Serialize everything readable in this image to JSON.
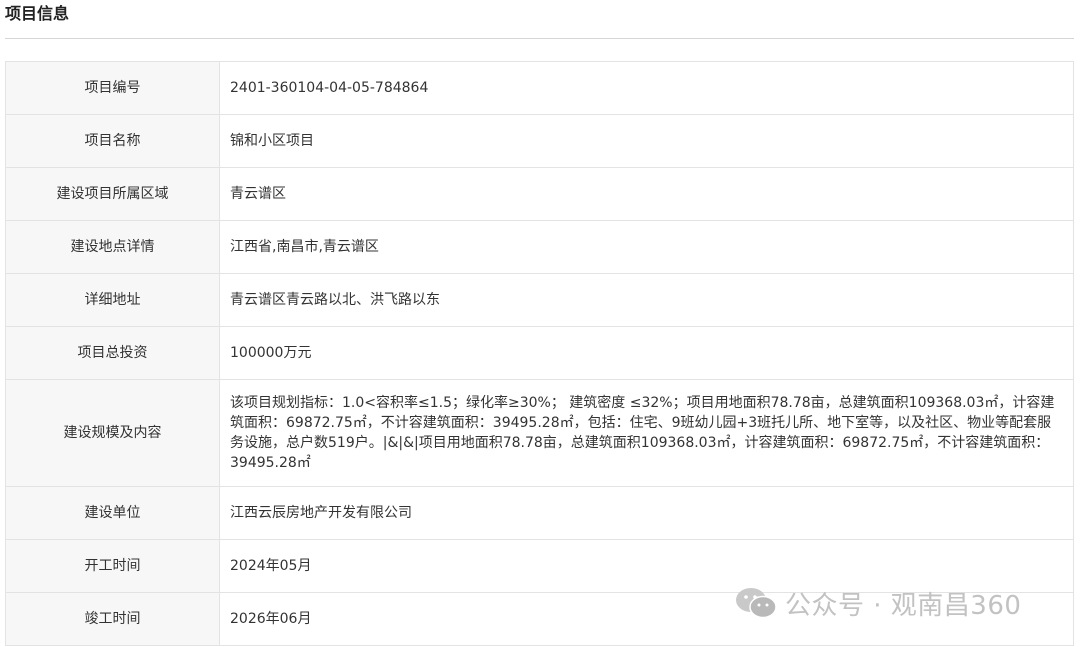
{
  "section": {
    "title": "项目信息"
  },
  "rows": [
    {
      "label": "项目编号",
      "value": "2401-360104-04-05-784864"
    },
    {
      "label": "项目名称",
      "value": "锦和小区项目"
    },
    {
      "label": "建设项目所属区域",
      "value": "青云谱区"
    },
    {
      "label": "建设地点详情",
      "value": "江西省,南昌市,青云谱区"
    },
    {
      "label": "详细地址",
      "value": "青云谱区青云路以北、洪飞路以东"
    },
    {
      "label": "项目总投资",
      "value": "100000万元"
    },
    {
      "label": "建设规模及内容",
      "value": "该项目规划指标：1.0<容积率≤1.5；绿化率≥30%；  建筑密度 ≤32%；项目用地面积78.78亩，总建筑面积109368.03㎡，计容建筑面积：69872.75㎡，不计容建筑面积：39495.28㎡，包括：住宅、9班幼儿园+3班托儿所、地下室等，以及社区、物业等配套服务设施，总户数519户。|&|&|项目用地面积78.78亩，总建筑面积109368.03㎡，计容建筑面积：69872.75㎡，不计容建筑面积：39495.28㎡"
    },
    {
      "label": "建设单位",
      "value": "江西云辰房地产开发有限公司"
    },
    {
      "label": "开工时间",
      "value": "2024年05月"
    },
    {
      "label": "竣工时间",
      "value": "2026年06月"
    }
  ],
  "watermark": {
    "text": "公众号 · 观南昌360",
    "icon": "wechat-icon",
    "color": "#c2c2c2"
  }
}
